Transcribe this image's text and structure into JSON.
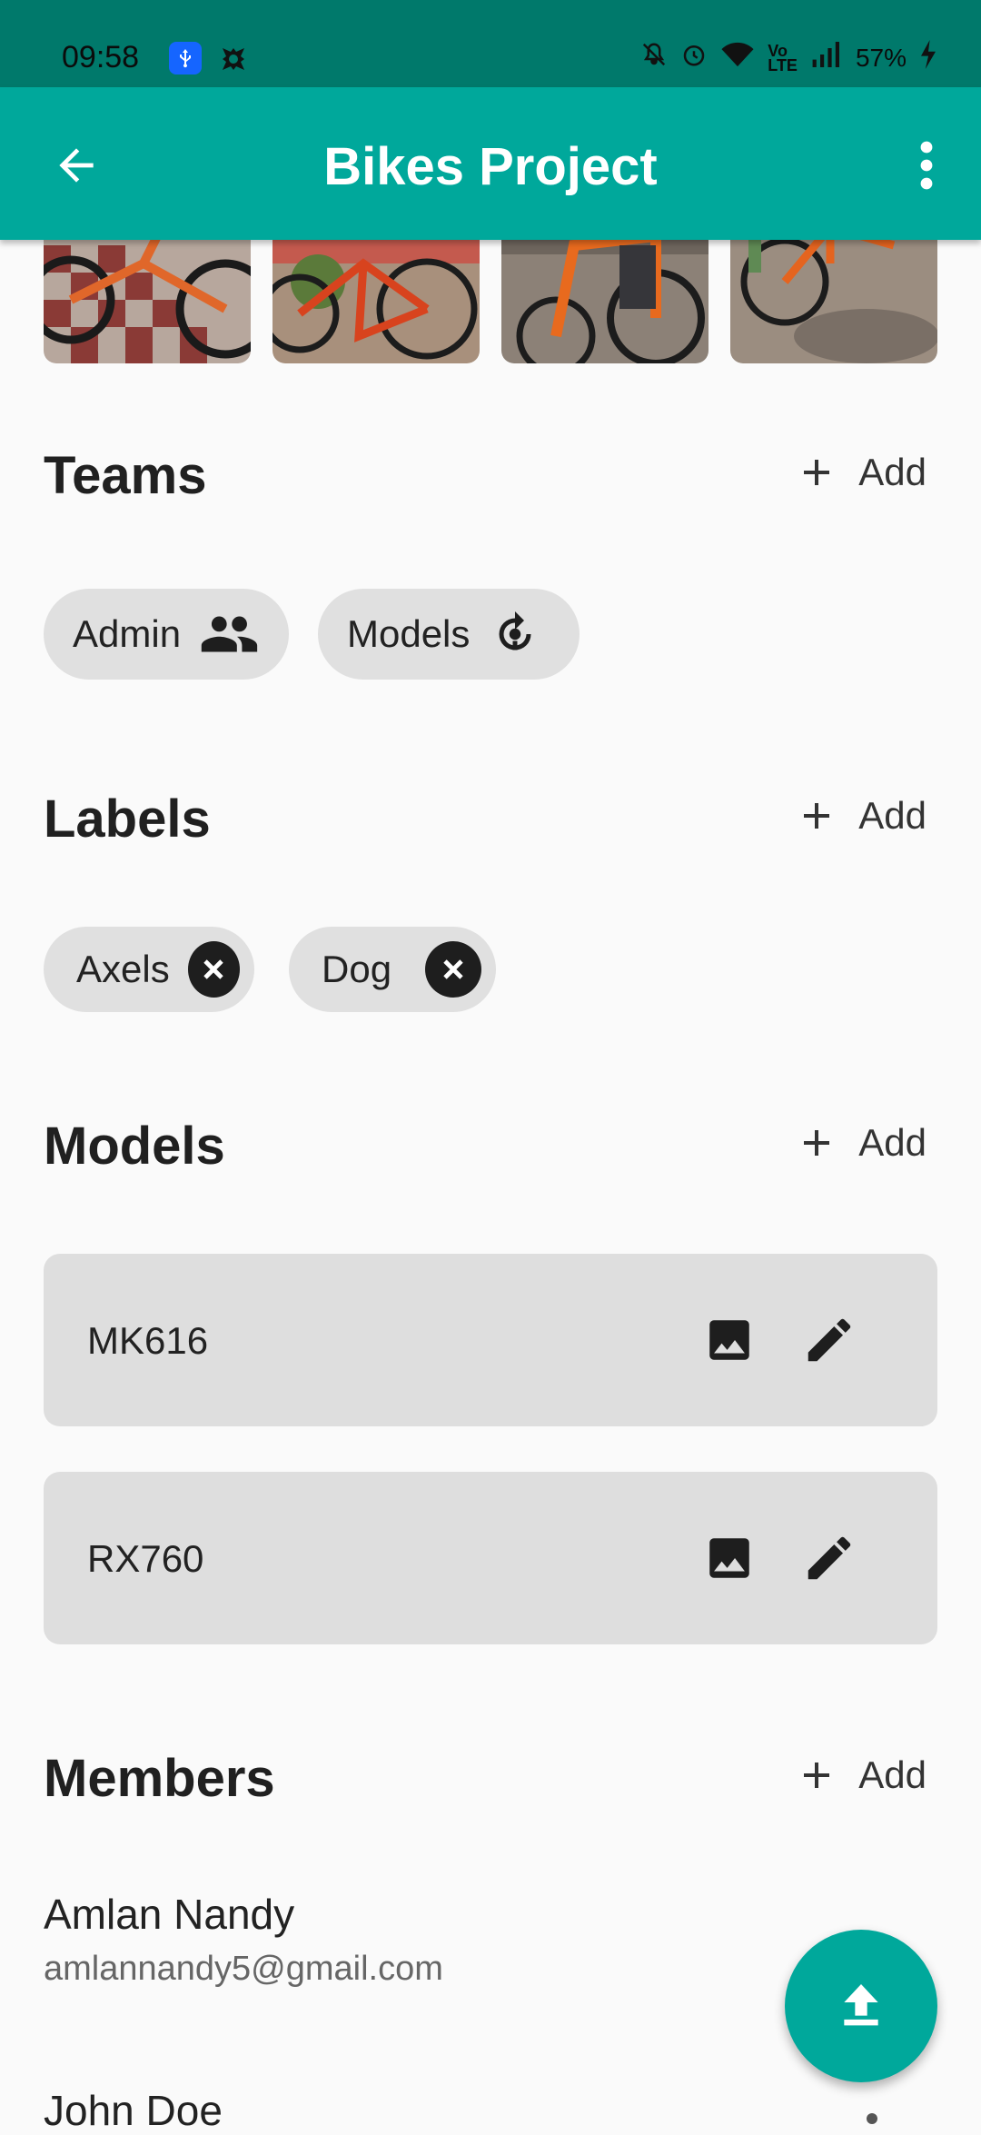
{
  "status_bar": {
    "time": "09:58",
    "battery": "57%",
    "icons": [
      "usb-icon",
      "app-notification-icon",
      "mute-icon",
      "alarm-icon",
      "wifi-icon",
      "volte-icon",
      "signal-icon",
      "battery-charging-icon"
    ]
  },
  "app_bar": {
    "title": "Bikes Project",
    "back_icon": "arrow-back-icon",
    "menu_icon": "more-vert-icon"
  },
  "gallery": {
    "images": [
      "bike-image-1",
      "bike-image-2",
      "bike-image-3",
      "bike-image-4"
    ]
  },
  "teams": {
    "title": "Teams",
    "add_label": "Add",
    "chips": [
      {
        "label": "Admin",
        "icon": "group-icon"
      },
      {
        "label": "Models",
        "icon": "model-training-icon"
      }
    ]
  },
  "labels": {
    "title": "Labels",
    "add_label": "Add",
    "chips": [
      {
        "label": "Axels"
      },
      {
        "label": "Dog"
      }
    ]
  },
  "models": {
    "title": "Models",
    "add_label": "Add",
    "items": [
      {
        "name": "MK616"
      },
      {
        "name": "RX760"
      }
    ]
  },
  "members": {
    "title": "Members",
    "add_label": "Add",
    "items": [
      {
        "name": "Amlan Nandy",
        "email": "amlannandy5@gmail.com"
      },
      {
        "name": "John Doe"
      }
    ]
  },
  "fab": {
    "icon": "upload-icon"
  },
  "colors": {
    "primary": "#00a89b",
    "status_bar": "#00796b",
    "chip_bg": "#e0e0e0",
    "card_bg": "#dedede"
  }
}
